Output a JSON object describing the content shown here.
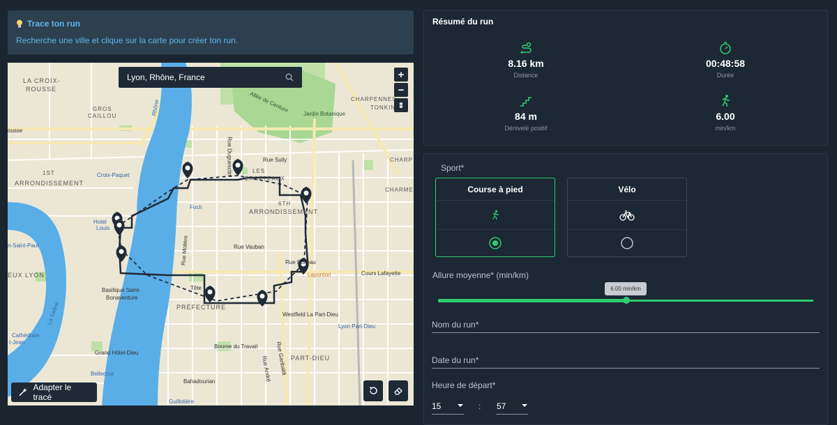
{
  "info": {
    "title": "Trace ton run",
    "desc": "Recherche une ville et clique sur la carte pour créer ton run."
  },
  "map": {
    "search_value": "Lyon, Rhône, France",
    "zoom_in": "+",
    "zoom_out": "−",
    "compass": "⇕",
    "adapt_label": "Adapter le tracé",
    "labels": [
      {
        "text": "LA CROIX-",
        "k": "lc1"
      },
      {
        "text": "ROUSSE",
        "k": "lc2"
      },
      {
        "text": "GROS",
        "k": "gc1"
      },
      {
        "text": "CAILLOU",
        "k": "gc2"
      },
      {
        "text": "1ST",
        "k": "a1"
      },
      {
        "text": "ARRONDISSEMENT",
        "k": "a1b"
      },
      {
        "text": "6TH",
        "k": "a6"
      },
      {
        "text": "ARRONDISSEMENT",
        "k": "a6b"
      },
      {
        "text": "LES",
        "k": "les"
      },
      {
        "text": "BROTTEAUX",
        "k": "br"
      },
      {
        "text": "CHARPENNES",
        "k": "ch"
      },
      {
        "text": "TONKIN",
        "k": "tk"
      },
      {
        "text": "PRÉFECTURE",
        "k": "pref"
      },
      {
        "text": "PART-DIEU",
        "k": "pd"
      },
      {
        "text": "EUX LYON",
        "k": "vl"
      },
      {
        "text": "Rue Vauban",
        "k": "rv"
      },
      {
        "text": "Cours Lafayette",
        "k": "cl"
      },
      {
        "text": "Allée de Centure",
        "k": "ac"
      },
      {
        "text": "Jardin Botanique",
        "k": "jb"
      },
      {
        "text": "Rue Sully",
        "k": "rs"
      },
      {
        "text": "Foch",
        "k": "foch"
      },
      {
        "text": "Croix-Paquet",
        "k": "cp"
      },
      {
        "text": "Hotel",
        "k": "ht"
      },
      {
        "text": "Louis",
        "k": "hl"
      },
      {
        "text": "Basilique Saint-",
        "k": "bs1"
      },
      {
        "text": "Bonaventure",
        "k": "bs2"
      },
      {
        "text": "Westfield La Part-Dieu",
        "k": "wf"
      },
      {
        "text": "Lyon Part-Dieu",
        "k": "lpd"
      },
      {
        "text": "Bourse du Travail",
        "k": "bt"
      },
      {
        "text": "Grand Hôtel-Dieu",
        "k": "ghd"
      },
      {
        "text": "Bahadourian",
        "k": "bh"
      },
      {
        "text": "Bellecour",
        "k": "bc"
      },
      {
        "text": "Guillotière",
        "k": "gu"
      },
      {
        "text": "n-Saint-Paul",
        "k": "sp"
      },
      {
        "text": "Cathédrale",
        "k": "cat"
      },
      {
        "text": "t-Jean",
        "k": "tj"
      },
      {
        "text": "Rhône",
        "k": "rh"
      },
      {
        "text": "La Saône",
        "k": "sa"
      },
      {
        "text": "Rue Duguesclin",
        "k": "rd"
      },
      {
        "text": "Rue Molière",
        "k": "rm"
      },
      {
        "text": "Rue Garibaldi",
        "k": "rg"
      },
      {
        "text": "Rue André",
        "k": "ra"
      },
      {
        "text": "Tête",
        "k": "tt"
      },
      {
        "text": "Rue Boileau",
        "k": "rb"
      },
      {
        "text": "Lapontori",
        "k": "lap"
      },
      {
        "text": "CHARP",
        "k": "chp"
      },
      {
        "text": "CHARME",
        "k": "chm"
      },
      {
        "text": "ousse",
        "k": "ou"
      }
    ]
  },
  "summary": {
    "title": "Résumé du run",
    "distance": {
      "value": "8.16 km",
      "label": "Distance"
    },
    "duration": {
      "value": "00:48:58",
      "label": "Durée"
    },
    "elevation": {
      "value": "84 m",
      "label": "Dénivelé positif"
    },
    "pace": {
      "value": "6.00",
      "label": "min/km"
    }
  },
  "form": {
    "sport_label": "Sport*",
    "sports": [
      {
        "name": "Course à pied",
        "selected": true
      },
      {
        "name": "Vélo",
        "selected": false
      }
    ],
    "pace_label": "Allure moyenne* (min/km)",
    "pace_tip": "6.00 min/km",
    "pace_value": 6.0,
    "name_label": "Nom du run*",
    "date_label": "Date du run*",
    "start_label": "Heure de départ*",
    "hour": "15",
    "minute": "57",
    "sep": ":"
  },
  "colors": {
    "accent": "#2ecc71",
    "info": "#5fb8e8",
    "route": "#1f2a36"
  }
}
